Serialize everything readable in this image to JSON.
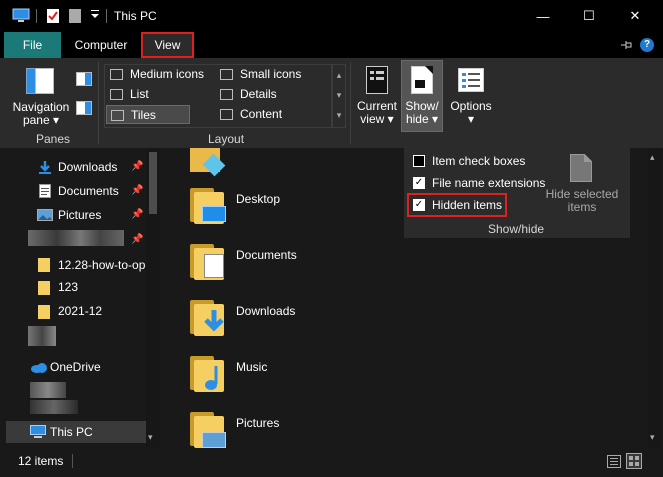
{
  "window": {
    "title": "This PC",
    "minimize_glyph": "—",
    "maximize_glyph": "☐",
    "close_glyph": "✕"
  },
  "tabs": {
    "file": "File",
    "computer": "Computer",
    "view": "View"
  },
  "ribbon": {
    "panes": {
      "navigation_pane_line1": "Navigation",
      "navigation_pane_line2": "pane",
      "group_label": "Panes"
    },
    "layout": {
      "items": [
        "Medium icons",
        "Small icons",
        "List",
        "Details",
        "Tiles",
        "Content"
      ],
      "selected": "Tiles",
      "group_label": "Layout"
    },
    "current_view": {
      "line1": "Current",
      "line2": "view"
    },
    "show_hide": {
      "line1": "Show/",
      "line2": "hide"
    },
    "options": "Options",
    "dropdown_arrow": "▾"
  },
  "show_hide_panel": {
    "item_check_boxes": {
      "label": "Item check boxes",
      "checked": false
    },
    "file_name_extensions": {
      "label": "File name extensions",
      "checked": true
    },
    "hidden_items": {
      "label": "Hidden items",
      "checked": true
    },
    "hide_selected_line1": "Hide selected",
    "hide_selected_line2": "items",
    "group_label": "Show/hide",
    "check_glyph": "✓"
  },
  "nav_pane": {
    "downloads": "Downloads",
    "documents": "Documents",
    "pictures": "Pictures",
    "folder1": "12.28-how-to-op",
    "folder2": "123",
    "folder3": "2021-12",
    "onedrive": "OneDrive",
    "this_pc": "This PC"
  },
  "main_files": [
    "Desktop",
    "Documents",
    "Downloads",
    "Music",
    "Pictures"
  ],
  "status_bar": {
    "item_count": "12 items"
  },
  "colors": {
    "file_tab": "#1b7a78",
    "highlight": "#e0201f",
    "folder": "#f6cf62",
    "accent_blue": "#2d8ee3"
  }
}
